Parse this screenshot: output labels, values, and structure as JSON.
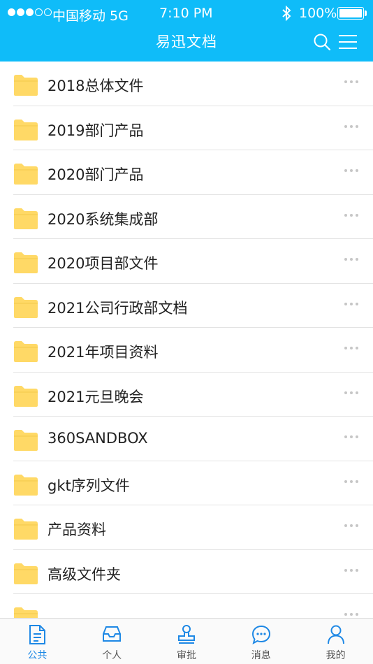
{
  "status_bar": {
    "carrier": "中国移动 5G",
    "time": "7:10 PM",
    "battery": "100%"
  },
  "header": {
    "title": "易迅文档",
    "search_icon": "search-icon",
    "menu_icon": "menu-icon"
  },
  "files": [
    {
      "name": "2018总体文件"
    },
    {
      "name": "2019部门产品"
    },
    {
      "name": "2020部门产品"
    },
    {
      "name": "2020系统集成部"
    },
    {
      "name": "2020项目部文件"
    },
    {
      "name": "2021公司行政部文档"
    },
    {
      "name": "2021年项目资料"
    },
    {
      "name": "2021元旦晚会"
    },
    {
      "name": "360SANDBOX"
    },
    {
      "name": "gkt序列文件"
    },
    {
      "name": "产品资料"
    },
    {
      "name": "高级文件夹"
    },
    {
      "name": ""
    }
  ],
  "tabbar": {
    "tabs": [
      {
        "label": "公共",
        "icon": "document-icon",
        "active": true
      },
      {
        "label": "个人",
        "icon": "inbox-icon",
        "active": false
      },
      {
        "label": "审批",
        "icon": "stamp-icon",
        "active": false
      },
      {
        "label": "消息",
        "icon": "chat-bubble-icon",
        "active": false
      },
      {
        "label": "我的",
        "icon": "user-icon",
        "active": false
      }
    ]
  },
  "colors": {
    "header_bg": "#0fbcf9",
    "folder": "#ffd966",
    "tab_active": "#1e88e5",
    "tab_inactive": "#1e88e5"
  }
}
